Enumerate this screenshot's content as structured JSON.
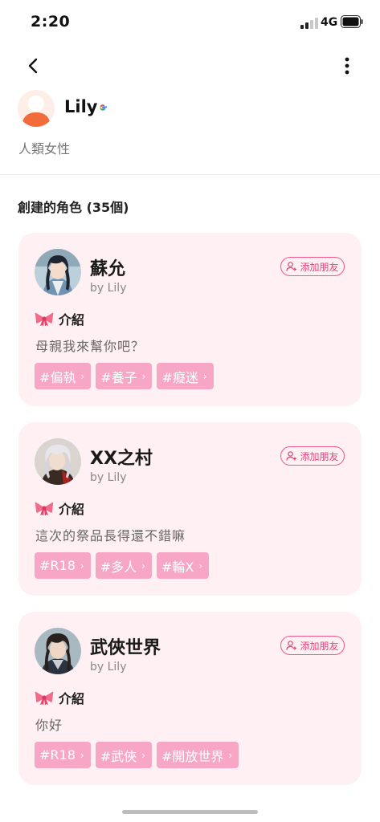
{
  "status_bar": {
    "time": "2:20",
    "network": "4G"
  },
  "profile": {
    "name": "Lily",
    "description": "人類女性"
  },
  "section": {
    "title": "創建的角色 (35個)"
  },
  "characters": [
    {
      "name": "蘇允",
      "by": "by Lily",
      "add_friend": "添加朋友",
      "intro_label": "介紹",
      "description": "母親我來幫你吧？",
      "tags": [
        "#偏執",
        "#養子",
        "#癡迷"
      ]
    },
    {
      "name": "XX之村",
      "by": "by Lily",
      "add_friend": "添加朋友",
      "intro_label": "介紹",
      "description": "這次的祭品長得還不錯嘛",
      "tags": [
        "#R18",
        "#多人",
        "#輪X"
      ]
    },
    {
      "name": "武俠世界",
      "by": "by Lily",
      "add_friend": "添加朋友",
      "intro_label": "介紹",
      "description": "你好",
      "tags": [
        "#R18",
        "#武俠",
        "#開放世界"
      ]
    }
  ],
  "colors": {
    "accent": "#e8437c",
    "card_bg": "#fff0f3",
    "tag_bg": "#f7a6c6"
  },
  "icons": [
    "back-arrow-icon",
    "more-vertical-icon",
    "google-icon",
    "add-user-icon",
    "ribbon-icon",
    "chevron-right-icon"
  ]
}
